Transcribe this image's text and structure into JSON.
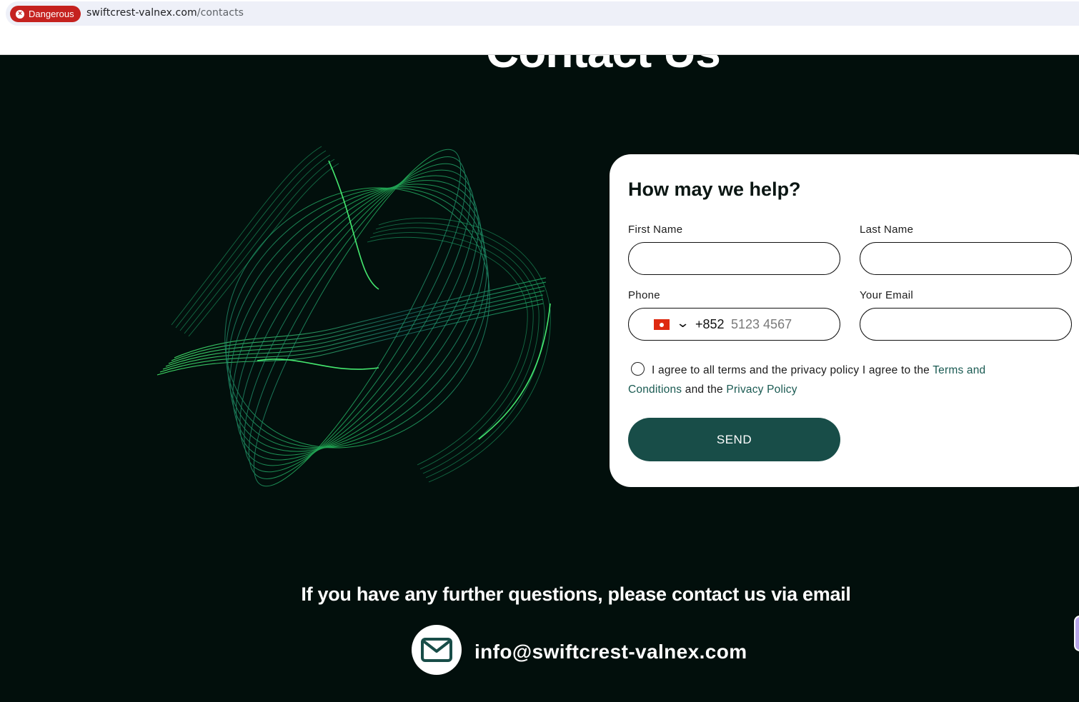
{
  "browser": {
    "security_badge": "Dangerous",
    "url_domain": "swiftcrest-valnex.com",
    "url_path": "/contacts"
  },
  "page": {
    "heading": "Contact Us"
  },
  "form": {
    "title": "How may we help?",
    "first_name_label": "First Name",
    "last_name_label": "Last Name",
    "phone_label": "Phone",
    "email_label": "Your Email",
    "phone_country_code": "+852",
    "phone_placeholder": "5123 4567",
    "agree_text_1": "I agree to all terms and the privacy policy I agree to the",
    "terms_link": "Terms and Conditions",
    "agree_text_2": "and the",
    "privacy_link": "Privacy Policy",
    "send_label": "SEND"
  },
  "contact": {
    "question": "If you have any further questions, please contact us via email",
    "email": "info@swiftcrest-valnex.com"
  },
  "colors": {
    "background": "#020f0c",
    "accent": "#184d48",
    "link": "#1a5a52",
    "danger": "#c5221f"
  },
  "icons": [
    "close-icon",
    "hk-flag-icon",
    "chevron-down-icon",
    "mail-icon"
  ]
}
